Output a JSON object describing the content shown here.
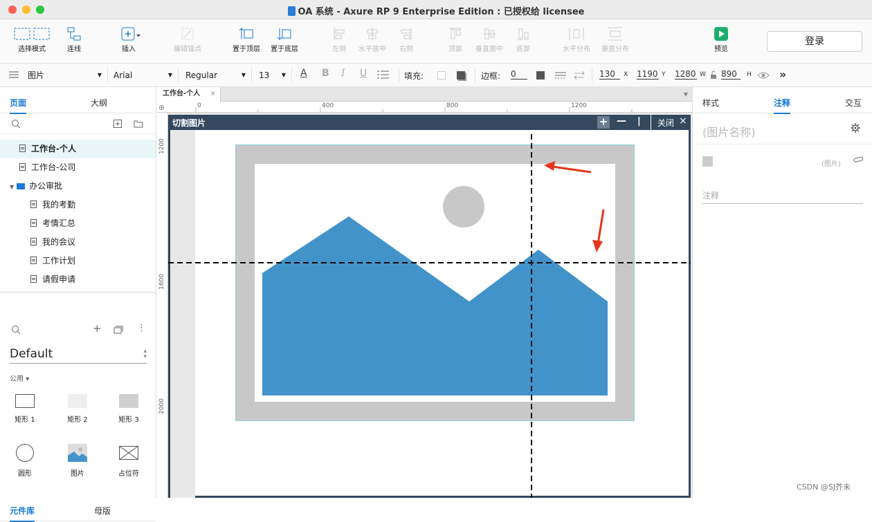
{
  "window": {
    "title": "OA 系统 - Axure RP 9 Enterprise Edition : 已授权给 licensee"
  },
  "toolbar": {
    "select_mode": "选择模式",
    "connect": "连线",
    "insert": "插入",
    "edit_anchor": "编辑锚点",
    "bring_top": "置于顶层",
    "send_bottom": "置于底层",
    "align_left": "左侧",
    "align_hcenter": "水平居中",
    "align_right": "右侧",
    "align_top": "顶部",
    "align_vcenter": "垂直居中",
    "align_bottom": "底部",
    "dist_h": "水平分布",
    "dist_v": "垂直分布",
    "preview": "预览",
    "login": "登录"
  },
  "format": {
    "widget_type": "图片",
    "font": "Arial",
    "weight": "Regular",
    "size": "13",
    "fill_label": "填充:",
    "border_label": "边框:",
    "border_value": "0",
    "x": "130",
    "x_label": "X",
    "y": "1190",
    "y_label": "Y",
    "w": "1280",
    "w_label": "W",
    "h": "890",
    "h_label": "H"
  },
  "left": {
    "tab_pages": "页面",
    "tab_outline": "大纲",
    "pages": [
      "工作台-个人",
      "工作台-公司",
      "办公审批",
      "我的考勤",
      "考情汇总",
      "我的会议",
      "工作计划",
      "请假申请"
    ],
    "tab_library": "元件库",
    "tab_masters": "母版",
    "library_name": "Default",
    "category": "公用",
    "widgets": [
      "矩形 1",
      "矩形 2",
      "矩形 3",
      "圆形",
      "图片",
      "占位符"
    ]
  },
  "canvas": {
    "tab": "工作台-个人",
    "ruler_h": [
      "0",
      "400",
      "800",
      "1200"
    ],
    "ruler_v": [
      "1200",
      "1600",
      "2000"
    ],
    "dialog_title": "切割图片",
    "close_label": "关闭"
  },
  "right": {
    "tab_style": "样式",
    "tab_notes": "注释",
    "tab_interact": "交互",
    "name_placeholder": "(图片名称)",
    "image_label": "(图片)",
    "notes_placeholder": "注释"
  },
  "watermark": "CSDN @SJ芥末",
  "colors": {
    "accent": "#1a7ad6",
    "dialog_header": "#34485e",
    "image_blue": "#4393cb",
    "image_gray": "#c8c8c8",
    "arrow_red": "#e8341c"
  }
}
